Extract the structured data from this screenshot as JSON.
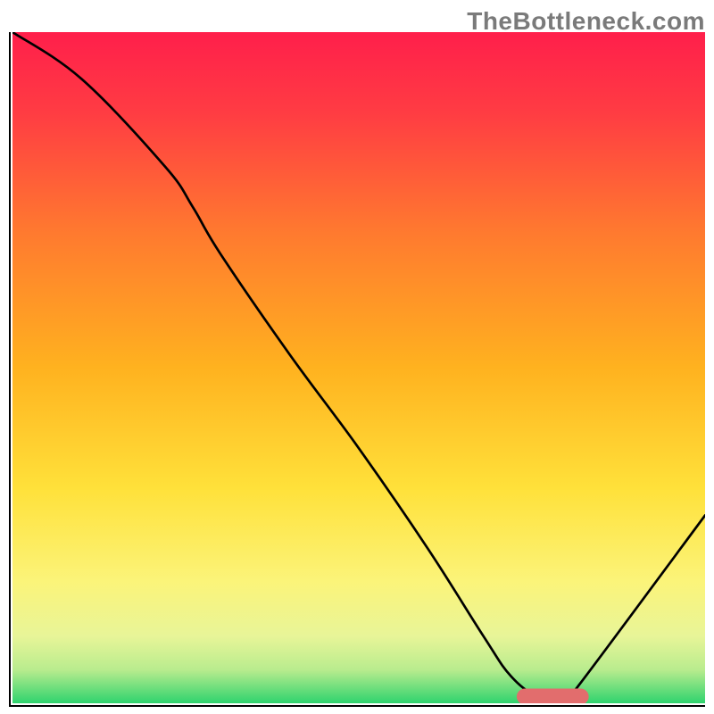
{
  "watermark": "TheBottleneck.com",
  "accent": {
    "marker_color": "#e26d6d"
  },
  "chart_data": {
    "type": "line",
    "title": "",
    "xlabel": "",
    "ylabel": "",
    "xlim": [
      0,
      100
    ],
    "ylim": [
      0,
      100
    ],
    "grid": false,
    "series": [
      {
        "name": "bottleneck-curve",
        "x": [
          0,
          10,
          22,
          26,
          30,
          40,
          50,
          60,
          68,
          72,
          76,
          80,
          82,
          100
        ],
        "y": [
          100,
          93,
          80,
          74,
          67,
          52,
          38,
          23,
          10,
          4,
          1,
          1,
          3,
          28
        ]
      }
    ],
    "marker": {
      "name": "optimal-range-marker",
      "x_start": 74,
      "x_end": 82,
      "y": 1,
      "thickness": 2.4
    },
    "background_gradient": {
      "stops": [
        {
          "pos": 0.0,
          "color": "#ff1f4b"
        },
        {
          "pos": 0.12,
          "color": "#ff3c43"
        },
        {
          "pos": 0.3,
          "color": "#ff7a2f"
        },
        {
          "pos": 0.5,
          "color": "#ffb21f"
        },
        {
          "pos": 0.68,
          "color": "#ffe13a"
        },
        {
          "pos": 0.82,
          "color": "#fbf47a"
        },
        {
          "pos": 0.9,
          "color": "#e8f598"
        },
        {
          "pos": 0.95,
          "color": "#b9ec8e"
        },
        {
          "pos": 1.0,
          "color": "#2fd36e"
        }
      ]
    }
  }
}
